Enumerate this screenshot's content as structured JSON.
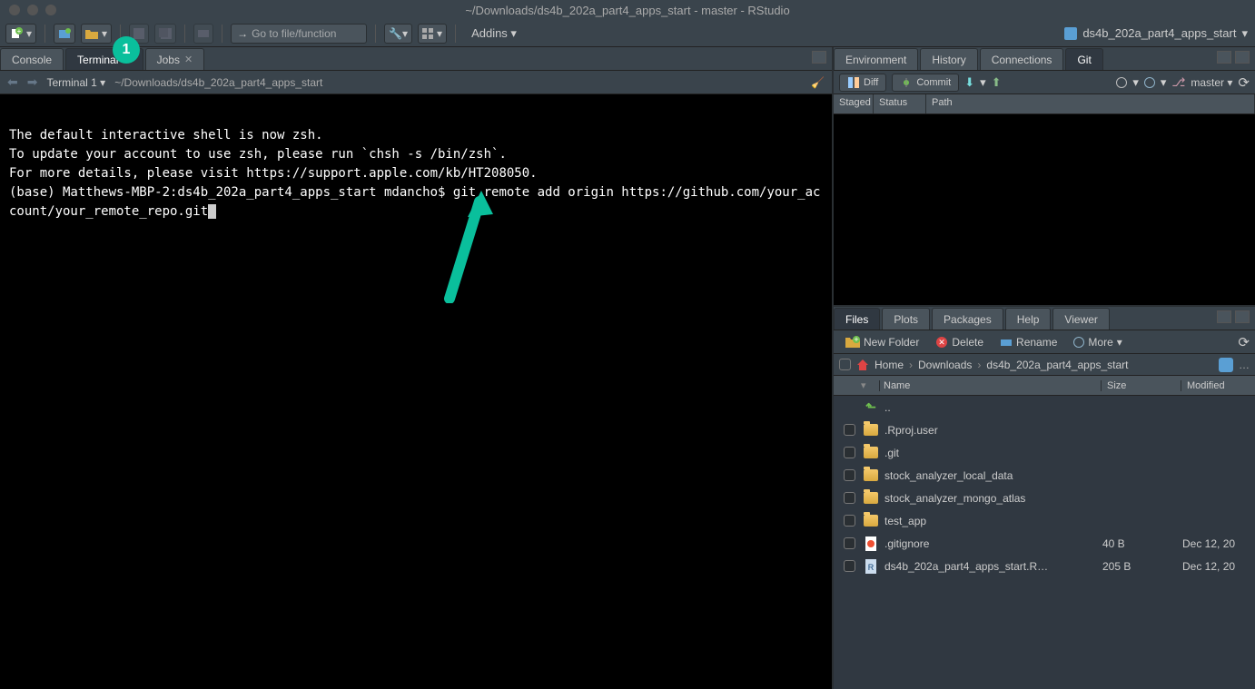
{
  "window": {
    "title": "~/Downloads/ds4b_202a_part4_apps_start - master - RStudio",
    "project_name": "ds4b_202a_part4_apps_start"
  },
  "toolbar": {
    "goto_placeholder": "Go to file/function",
    "addins_label": "Addins"
  },
  "left_pane": {
    "tabs": [
      {
        "label": "Console",
        "active": false
      },
      {
        "label": "Terminal",
        "active": true,
        "closable": true
      },
      {
        "label": "Jobs",
        "active": false,
        "closable": true
      }
    ],
    "terminal_name": "Terminal 1",
    "terminal_path": "~/Downloads/ds4b_202a_part4_apps_start",
    "terminal_lines": "\nThe default interactive shell is now zsh.\nTo update your account to use zsh, please run `chsh -s /bin/zsh`.\nFor more details, please visit https://support.apple.com/kb/HT208050.\n(base) Matthews-MBP-2:ds4b_202a_part4_apps_start mdancho$ git remote add origin https://github.com/your_account/your_remote_repo.git"
  },
  "right_top": {
    "tabs": [
      {
        "label": "Environment"
      },
      {
        "label": "History"
      },
      {
        "label": "Connections"
      },
      {
        "label": "Git",
        "active": true
      }
    ],
    "git_buttons": {
      "diff": "Diff",
      "commit": "Commit"
    },
    "branch": "master",
    "columns": {
      "staged": "Staged",
      "status": "Status",
      "path": "Path"
    }
  },
  "right_bottom": {
    "tabs": [
      {
        "label": "Files",
        "active": true
      },
      {
        "label": "Plots"
      },
      {
        "label": "Packages"
      },
      {
        "label": "Help"
      },
      {
        "label": "Viewer"
      }
    ],
    "buttons": {
      "new_folder": "New Folder",
      "delete": "Delete",
      "rename": "Rename",
      "more": "More"
    },
    "breadcrumb": [
      "Home",
      "Downloads",
      "ds4b_202a_part4_apps_start"
    ],
    "columns": {
      "name": "Name",
      "size": "Size",
      "modified": "Modified"
    },
    "rows": [
      {
        "type": "up",
        "name": ".."
      },
      {
        "type": "folder",
        "name": ".Rproj.user"
      },
      {
        "type": "folder",
        "name": ".git"
      },
      {
        "type": "folder",
        "name": "stock_analyzer_local_data"
      },
      {
        "type": "folder",
        "name": "stock_analyzer_mongo_atlas"
      },
      {
        "type": "folder",
        "name": "test_app"
      },
      {
        "type": "gitfile",
        "name": ".gitignore",
        "size": "40 B",
        "modified": "Dec 12, 20"
      },
      {
        "type": "rproj",
        "name": "ds4b_202a_part4_apps_start.R…",
        "size": "205 B",
        "modified": "Dec 12, 20"
      }
    ]
  },
  "annotation": {
    "badge": "1"
  }
}
